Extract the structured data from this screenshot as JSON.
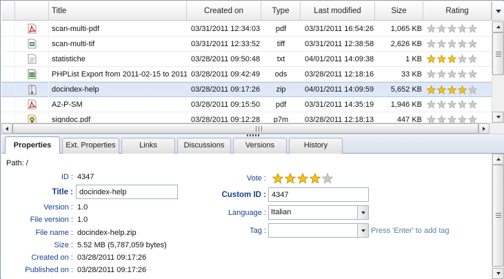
{
  "grid": {
    "columns": [
      "Title",
      "Created on",
      "Type",
      "Last modified",
      "Size",
      "Rating"
    ],
    "rows": [
      {
        "icon": "pdf",
        "title": "scan-multi-pdf",
        "created": "03/31/2011 12:34:03",
        "type": "pdf",
        "modified": "03/31/2011 16:54:26",
        "size": "1,065 KB",
        "rating": 0,
        "selected": false
      },
      {
        "icon": "tiff",
        "title": "scan-multi-tif",
        "created": "03/31/2011 12:33:52",
        "type": "tiff",
        "modified": "03/31/2011 12:38:58",
        "size": "2,626 KB",
        "rating": 0,
        "selected": false
      },
      {
        "icon": "txt",
        "title": "statistiche",
        "created": "03/28/2011 09:50:48",
        "type": "txt",
        "modified": "04/01/2011 14:09:38",
        "size": "1 KB",
        "rating": 3,
        "selected": false
      },
      {
        "icon": "ods",
        "title": "PHPList Export from 2011-02-15 to 2011-",
        "created": "03/28/2011 09:42:49",
        "type": "ods",
        "modified": "03/28/2011 12:18:16",
        "size": "33 KB",
        "rating": 0,
        "selected": false
      },
      {
        "icon": "zip",
        "title": "docindex-help",
        "created": "03/28/2011 09:17:26",
        "type": "zip",
        "modified": "04/01/2011 14:09:59",
        "size": "5,652 KB",
        "rating": 4,
        "selected": true
      },
      {
        "icon": "pdf",
        "title": "A2-P-SM",
        "created": "03/28/2011 09:15:50",
        "type": "pdf",
        "modified": "03/31/2011 14:35:19",
        "size": "1,946 KB",
        "rating": 0,
        "selected": false
      },
      {
        "icon": "p7m",
        "title": "signdoc.pdf",
        "created": "03/28/2011 09:12:28",
        "type": "p7m",
        "modified": "03/28/2011 12:18:13",
        "size": "447 KB",
        "rating": 0,
        "selected": false
      }
    ]
  },
  "tabs": [
    "Properties",
    "Ext. Properties",
    "Links",
    "Discussions",
    "Versions",
    "History"
  ],
  "properties": {
    "path_label": "Path: /",
    "id_label": "ID :",
    "id_value": "4347",
    "title_label": "Title :",
    "title_value": "docindex-help",
    "version_label": "Version :",
    "version_value": "1.0",
    "file_version_label": "File version :",
    "file_version_value": "1.0",
    "file_name_label": "File name :",
    "file_name_value": "docindex-help.zip",
    "size_label": "Size :",
    "size_value": "5.52 MB (5,787,059 bytes)",
    "created_label": "Created on :",
    "created_value": "03/28/2011 09:17:26",
    "published_label": "Published on :",
    "published_value": "03/28/2011 09:17:26",
    "vote_label": "Vote :",
    "vote_value": 4,
    "custom_id_label": "Custom ID :",
    "custom_id_value": "4347",
    "language_label": "Language :",
    "language_value": "Italian",
    "tag_label": "Tag :",
    "tag_value": "",
    "tag_hint": "Press 'Enter' to add tag"
  },
  "colors": {
    "accent": "#15428b",
    "selected_row": "#dfe8f6",
    "star_on": "#f3c21a",
    "star_off": "#c9c9c9"
  }
}
